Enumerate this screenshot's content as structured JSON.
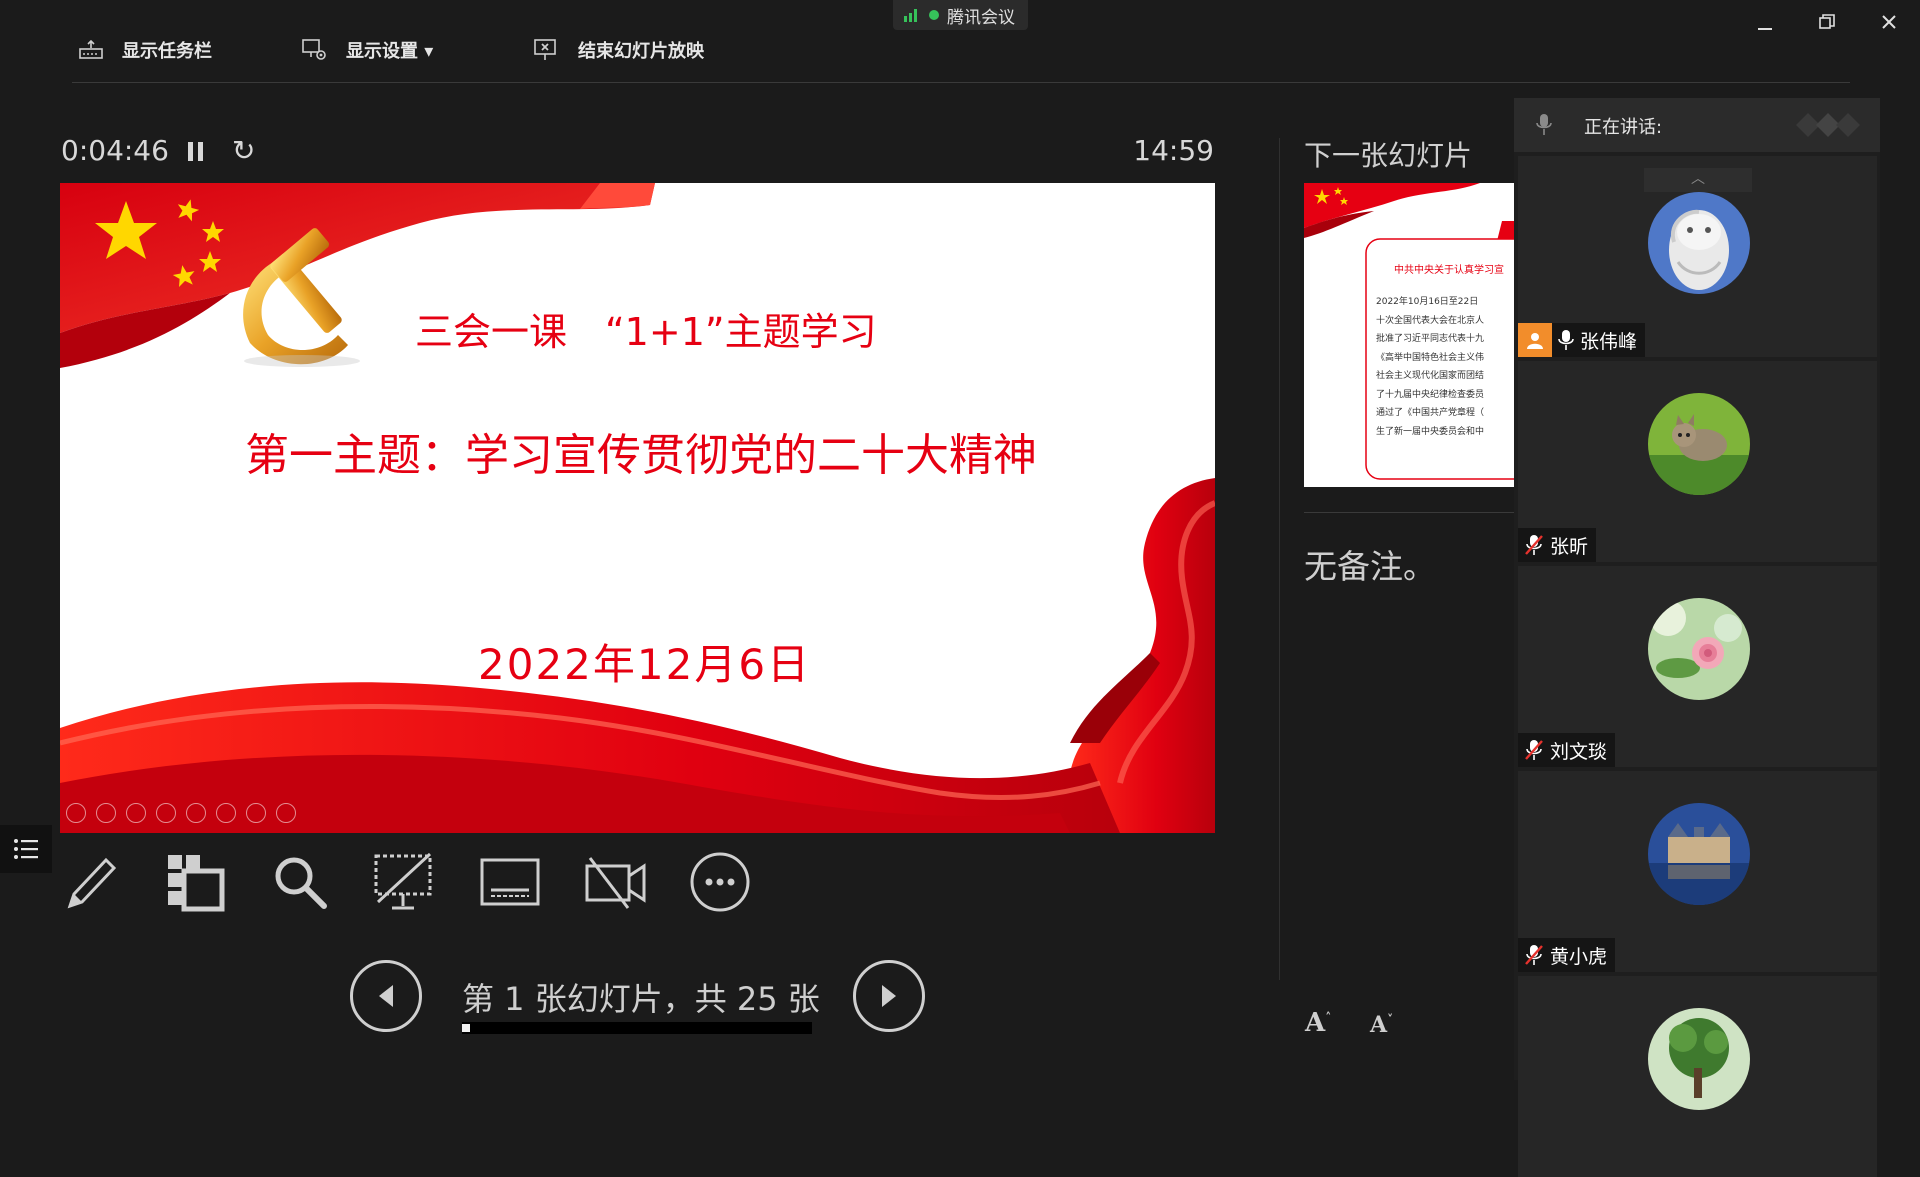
{
  "window": {
    "app_badge": "腾讯会议",
    "signal_color": "#36c25a",
    "controls": [
      "minimize",
      "restore",
      "close"
    ]
  },
  "toolbar": {
    "show_taskbar": "显示任务栏",
    "display_settings": "显示设置 ▾",
    "end_slideshow": "结束幻灯片放映"
  },
  "timer": {
    "elapsed": "0:04:46",
    "clock": "14:59"
  },
  "slide": {
    "line1": "三会一课　“1+1”主题学习",
    "line2": "第一主题：学习宣传贯彻党的二十大精神",
    "date": "2022年12月6日",
    "text_color": "#e60012"
  },
  "next_slide": {
    "label": "下一张幻灯片",
    "thumb_title": "中共中央关于认真学习宣",
    "thumb_lines": [
      "2022年10月16日至22日",
      "十次全国代表大会在北京人",
      "批准了习近平同志代表十九",
      "《高举中国特色社会主义伟",
      "社会主义现代化国家而团结",
      "了十九届中央纪律检查委员",
      "通过了《中国共产党章程（",
      "生了新一届中央委员会和中"
    ]
  },
  "notes": {
    "text": "无备注。"
  },
  "navigation": {
    "counter": "第 1 张幻灯片，共 25 张",
    "current": 1,
    "total": 25
  },
  "tools": [
    "pen-tool",
    "slides-grid",
    "zoom",
    "screen-blackout",
    "subtitles",
    "camera-off",
    "more-options"
  ],
  "participants": {
    "speaking_label": "正在讲话:",
    "list": [
      {
        "name": "张伟峰",
        "mic": "on",
        "host": true
      },
      {
        "name": "张昕",
        "mic": "off"
      },
      {
        "name": "刘文琰",
        "mic": "off"
      },
      {
        "name": "黄小虎",
        "mic": "off"
      },
      {
        "name": "",
        "mic": "off"
      }
    ]
  }
}
